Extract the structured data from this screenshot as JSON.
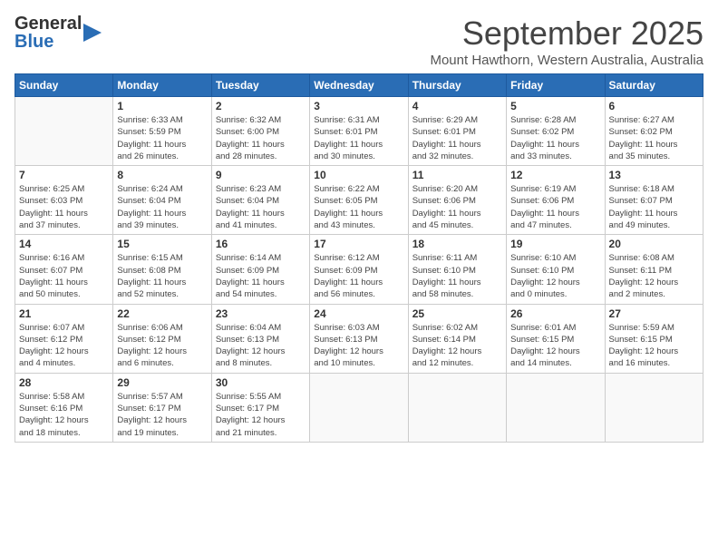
{
  "header": {
    "logo_general": "General",
    "logo_blue": "Blue",
    "month_title": "September 2025",
    "subtitle": "Mount Hawthorn, Western Australia, Australia"
  },
  "weekdays": [
    "Sunday",
    "Monday",
    "Tuesday",
    "Wednesday",
    "Thursday",
    "Friday",
    "Saturday"
  ],
  "weeks": [
    [
      {
        "day": "",
        "info": ""
      },
      {
        "day": "1",
        "info": "Sunrise: 6:33 AM\nSunset: 5:59 PM\nDaylight: 11 hours\nand 26 minutes."
      },
      {
        "day": "2",
        "info": "Sunrise: 6:32 AM\nSunset: 6:00 PM\nDaylight: 11 hours\nand 28 minutes."
      },
      {
        "day": "3",
        "info": "Sunrise: 6:31 AM\nSunset: 6:01 PM\nDaylight: 11 hours\nand 30 minutes."
      },
      {
        "day": "4",
        "info": "Sunrise: 6:29 AM\nSunset: 6:01 PM\nDaylight: 11 hours\nand 32 minutes."
      },
      {
        "day": "5",
        "info": "Sunrise: 6:28 AM\nSunset: 6:02 PM\nDaylight: 11 hours\nand 33 minutes."
      },
      {
        "day": "6",
        "info": "Sunrise: 6:27 AM\nSunset: 6:02 PM\nDaylight: 11 hours\nand 35 minutes."
      }
    ],
    [
      {
        "day": "7",
        "info": "Sunrise: 6:25 AM\nSunset: 6:03 PM\nDaylight: 11 hours\nand 37 minutes."
      },
      {
        "day": "8",
        "info": "Sunrise: 6:24 AM\nSunset: 6:04 PM\nDaylight: 11 hours\nand 39 minutes."
      },
      {
        "day": "9",
        "info": "Sunrise: 6:23 AM\nSunset: 6:04 PM\nDaylight: 11 hours\nand 41 minutes."
      },
      {
        "day": "10",
        "info": "Sunrise: 6:22 AM\nSunset: 6:05 PM\nDaylight: 11 hours\nand 43 minutes."
      },
      {
        "day": "11",
        "info": "Sunrise: 6:20 AM\nSunset: 6:06 PM\nDaylight: 11 hours\nand 45 minutes."
      },
      {
        "day": "12",
        "info": "Sunrise: 6:19 AM\nSunset: 6:06 PM\nDaylight: 11 hours\nand 47 minutes."
      },
      {
        "day": "13",
        "info": "Sunrise: 6:18 AM\nSunset: 6:07 PM\nDaylight: 11 hours\nand 49 minutes."
      }
    ],
    [
      {
        "day": "14",
        "info": "Sunrise: 6:16 AM\nSunset: 6:07 PM\nDaylight: 11 hours\nand 50 minutes."
      },
      {
        "day": "15",
        "info": "Sunrise: 6:15 AM\nSunset: 6:08 PM\nDaylight: 11 hours\nand 52 minutes."
      },
      {
        "day": "16",
        "info": "Sunrise: 6:14 AM\nSunset: 6:09 PM\nDaylight: 11 hours\nand 54 minutes."
      },
      {
        "day": "17",
        "info": "Sunrise: 6:12 AM\nSunset: 6:09 PM\nDaylight: 11 hours\nand 56 minutes."
      },
      {
        "day": "18",
        "info": "Sunrise: 6:11 AM\nSunset: 6:10 PM\nDaylight: 11 hours\nand 58 minutes."
      },
      {
        "day": "19",
        "info": "Sunrise: 6:10 AM\nSunset: 6:10 PM\nDaylight: 12 hours\nand 0 minutes."
      },
      {
        "day": "20",
        "info": "Sunrise: 6:08 AM\nSunset: 6:11 PM\nDaylight: 12 hours\nand 2 minutes."
      }
    ],
    [
      {
        "day": "21",
        "info": "Sunrise: 6:07 AM\nSunset: 6:12 PM\nDaylight: 12 hours\nand 4 minutes."
      },
      {
        "day": "22",
        "info": "Sunrise: 6:06 AM\nSunset: 6:12 PM\nDaylight: 12 hours\nand 6 minutes."
      },
      {
        "day": "23",
        "info": "Sunrise: 6:04 AM\nSunset: 6:13 PM\nDaylight: 12 hours\nand 8 minutes."
      },
      {
        "day": "24",
        "info": "Sunrise: 6:03 AM\nSunset: 6:13 PM\nDaylight: 12 hours\nand 10 minutes."
      },
      {
        "day": "25",
        "info": "Sunrise: 6:02 AM\nSunset: 6:14 PM\nDaylight: 12 hours\nand 12 minutes."
      },
      {
        "day": "26",
        "info": "Sunrise: 6:01 AM\nSunset: 6:15 PM\nDaylight: 12 hours\nand 14 minutes."
      },
      {
        "day": "27",
        "info": "Sunrise: 5:59 AM\nSunset: 6:15 PM\nDaylight: 12 hours\nand 16 minutes."
      }
    ],
    [
      {
        "day": "28",
        "info": "Sunrise: 5:58 AM\nSunset: 6:16 PM\nDaylight: 12 hours\nand 18 minutes."
      },
      {
        "day": "29",
        "info": "Sunrise: 5:57 AM\nSunset: 6:17 PM\nDaylight: 12 hours\nand 19 minutes."
      },
      {
        "day": "30",
        "info": "Sunrise: 5:55 AM\nSunset: 6:17 PM\nDaylight: 12 hours\nand 21 minutes."
      },
      {
        "day": "",
        "info": ""
      },
      {
        "day": "",
        "info": ""
      },
      {
        "day": "",
        "info": ""
      },
      {
        "day": "",
        "info": ""
      }
    ]
  ]
}
